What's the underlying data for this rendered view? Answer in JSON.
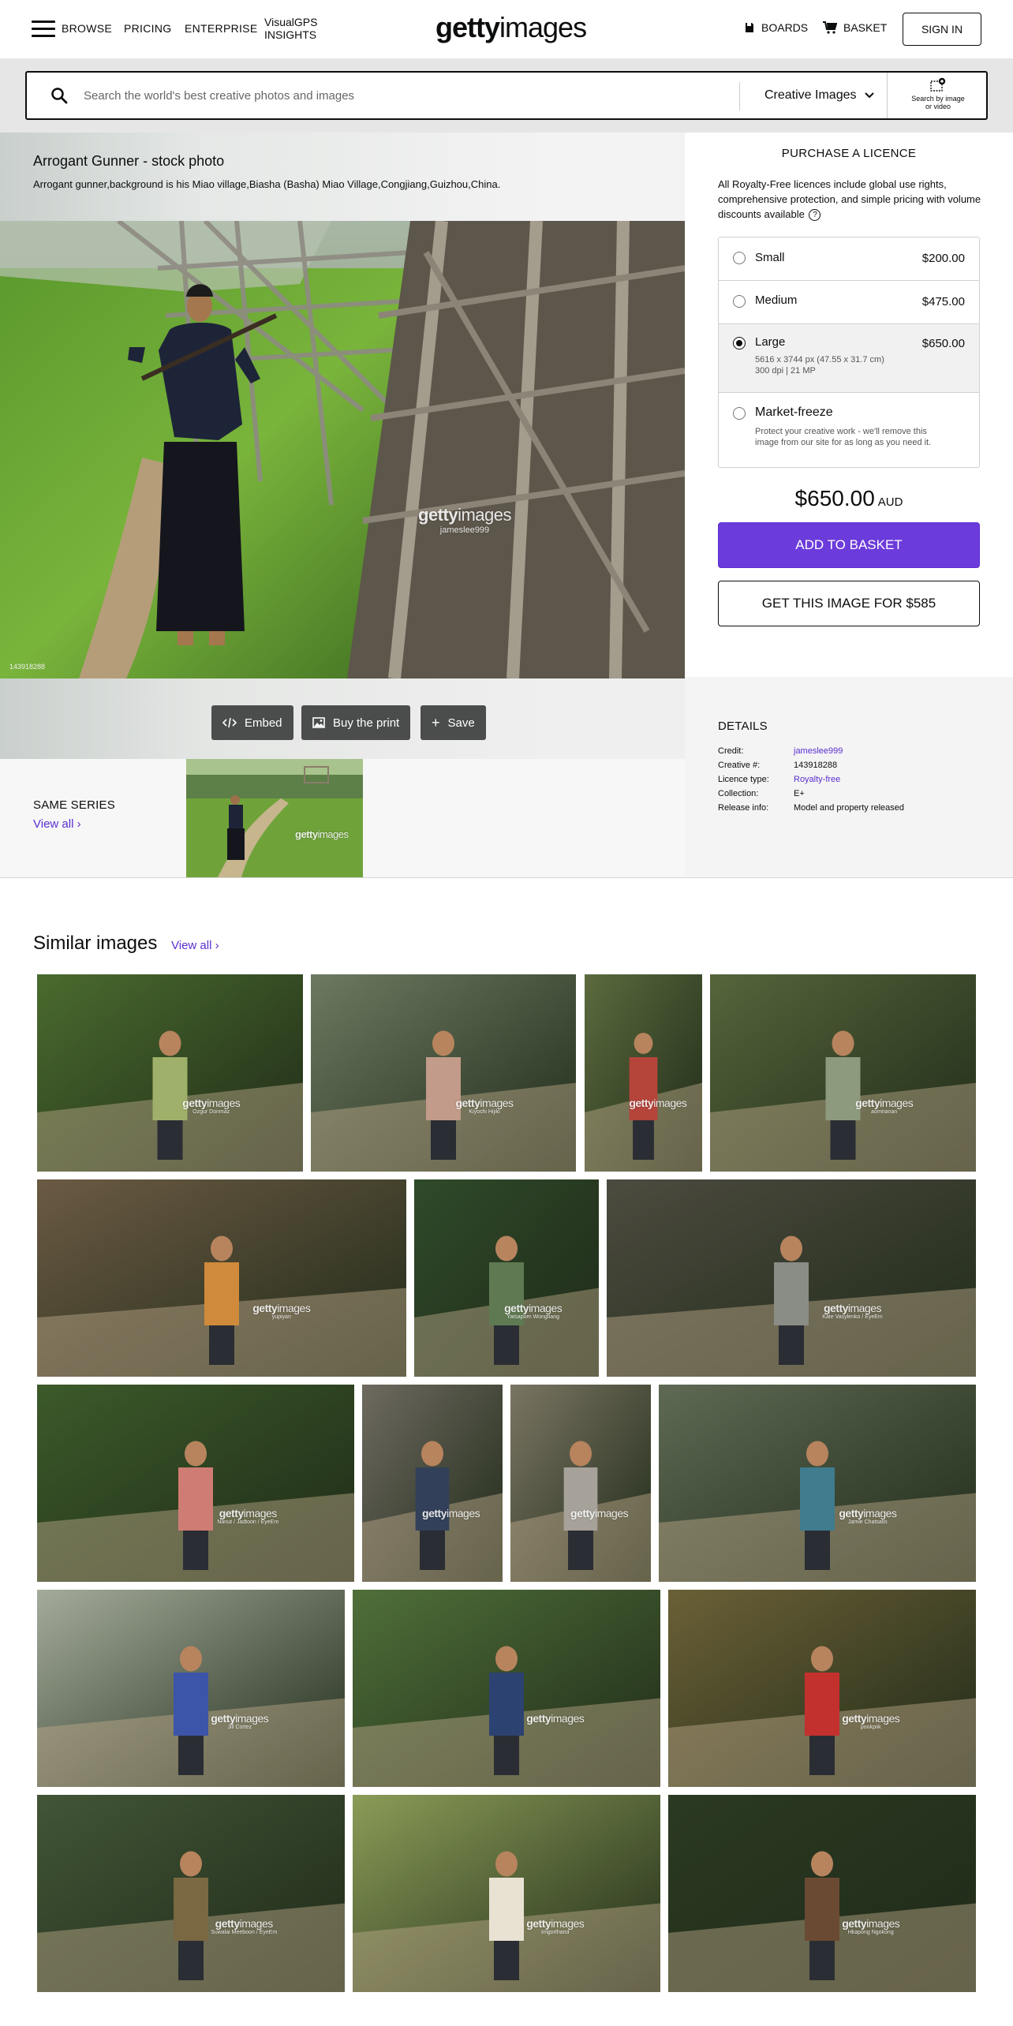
{
  "header": {
    "nav": {
      "browse": "BROWSE",
      "pricing": "PRICING",
      "enterprise": "ENTERPRISE",
      "visualgps_line1": "VisualGPS",
      "visualgps_line2": "INSIGHTS"
    },
    "logo_bold": "getty",
    "logo_light": "images",
    "boards": "BOARDS",
    "basket": "BASKET",
    "signin": "SIGN IN"
  },
  "search": {
    "placeholder": "Search the world's best creative photos and images",
    "type": "Creative Images",
    "by_image_line1": "Search by image",
    "by_image_line2": "or video"
  },
  "photo": {
    "title": "Arrogant Gunner - stock photo",
    "caption": "Arrogant gunner,background is his Miao village,Biasha (Basha) Miao Village,Congjiang,Guizhou,China.",
    "id_label": "143918288",
    "watermark_credit": "jameslee999"
  },
  "actions": {
    "embed": "Embed",
    "buy_print": "Buy the print",
    "save": "Save"
  },
  "same_series": {
    "label": "SAME SERIES",
    "view_all": "View all"
  },
  "licence": {
    "title": "PURCHASE A LICENCE",
    "description": "All Royalty-Free licences include global use rights, comprehensive protection, and simple pricing with volume discounts available",
    "options": [
      {
        "name": "Small",
        "price": "$200.00",
        "selected": false
      },
      {
        "name": "Medium",
        "price": "$475.00",
        "selected": false
      },
      {
        "name": "Large",
        "price": "$650.00",
        "selected": true,
        "sub1": "5616 x 3744 px (47.55 x 31.7 cm)",
        "sub2": "300 dpi | 21 MP"
      },
      {
        "name": "Market-freeze",
        "price": "",
        "selected": false,
        "sub1": "Protect your creative work - we'll remove this image from our site for as long as you need it."
      }
    ],
    "total": "$650.00",
    "currency": "AUD",
    "add_to_basket": "ADD TO BASKET",
    "get_image": "GET THIS IMAGE FOR $585"
  },
  "details": {
    "title": "DETAILS",
    "rows": [
      {
        "k": "Credit:",
        "v": "jameslee999"
      },
      {
        "k": "Creative #:",
        "v": "143918288"
      },
      {
        "k": "Licence type:",
        "v": "Royalty-free"
      },
      {
        "k": "Collection:",
        "v": "E+"
      },
      {
        "k": "Release info:",
        "v": "Model and property released"
      }
    ]
  },
  "similar": {
    "title": "Similar images",
    "view_all": "View all",
    "tiles": [
      {
        "credit": "Ozgur Donmaz"
      },
      {
        "credit": "Kiyoshi Hijiki"
      },
      {
        "credit": ""
      },
      {
        "credit": "aomnanan"
      },
      {
        "credit": "yupiyan"
      },
      {
        "credit": "Yatsaporn Wongtiang"
      },
      {
        "credit": "Kate Vasylenko / EyeEm"
      },
      {
        "credit": "Nanut / Jadtoon / EyeEm"
      },
      {
        "credit": ""
      },
      {
        "credit": ""
      },
      {
        "credit": "Jamie Chatsatis"
      },
      {
        "credit": "Jill Cortez"
      },
      {
        "credit": ""
      },
      {
        "credit": "pookpiik"
      },
      {
        "credit": "Suwalai Meeboon / EyeEm"
      },
      {
        "credit": "Imgorthand"
      },
      {
        "credit": "Hkapong Ngokong"
      }
    ]
  },
  "colors": {
    "accent": "#6c3bdb",
    "link": "#5a2fd1",
    "action_button": "#4b4d4d"
  }
}
